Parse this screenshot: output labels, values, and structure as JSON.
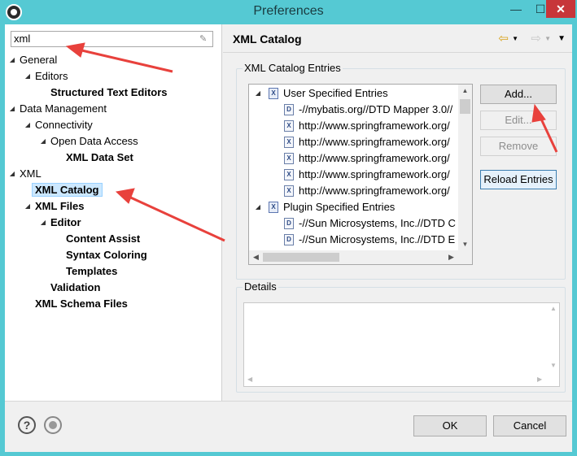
{
  "window": {
    "title": "Preferences"
  },
  "filter": {
    "value": "xml"
  },
  "tree": [
    {
      "label": "General",
      "level": 0,
      "twisty": "open",
      "bold": false
    },
    {
      "label": "Editors",
      "level": 1,
      "twisty": "open",
      "bold": false
    },
    {
      "label": "Structured Text Editors",
      "level": 2,
      "twisty": "none",
      "bold": true
    },
    {
      "label": "Data Management",
      "level": 0,
      "twisty": "open",
      "bold": false
    },
    {
      "label": "Connectivity",
      "level": 1,
      "twisty": "open",
      "bold": false
    },
    {
      "label": "Open Data Access",
      "level": 2,
      "twisty": "open",
      "bold": false
    },
    {
      "label": "XML Data Set",
      "level": 3,
      "twisty": "none",
      "bold": true
    },
    {
      "label": "XML",
      "level": 0,
      "twisty": "open",
      "bold": false
    },
    {
      "label": "XML Catalog",
      "level": 1,
      "twisty": "none",
      "bold": true,
      "selected": true
    },
    {
      "label": "XML Files",
      "level": 1,
      "twisty": "open",
      "bold": true
    },
    {
      "label": "Editor",
      "level": 2,
      "twisty": "open",
      "bold": true
    },
    {
      "label": "Content Assist",
      "level": 3,
      "twisty": "none",
      "bold": true
    },
    {
      "label": "Syntax Coloring",
      "level": 3,
      "twisty": "none",
      "bold": true
    },
    {
      "label": "Templates",
      "level": 3,
      "twisty": "none",
      "bold": true
    },
    {
      "label": "Validation",
      "level": 2,
      "twisty": "none",
      "bold": true
    },
    {
      "label": "XML Schema Files",
      "level": 1,
      "twisty": "none",
      "bold": true
    }
  ],
  "page": {
    "title": "XML Catalog",
    "catalog_group_label": "XML Catalog Entries",
    "details_group_label": "Details"
  },
  "entries": [
    {
      "label": "User Specified Entries",
      "type": "group",
      "icon": "X"
    },
    {
      "label": "-//mybatis.org//DTD Mapper 3.0//",
      "type": "dtd",
      "icon": "D"
    },
    {
      "label": "http://www.springframework.org/",
      "type": "xsd",
      "icon": "X"
    },
    {
      "label": "http://www.springframework.org/",
      "type": "xsd",
      "icon": "X"
    },
    {
      "label": "http://www.springframework.org/",
      "type": "xsd",
      "icon": "X"
    },
    {
      "label": "http://www.springframework.org/",
      "type": "xsd",
      "icon": "X"
    },
    {
      "label": "http://www.springframework.org/",
      "type": "xsd",
      "icon": "X"
    },
    {
      "label": "Plugin Specified Entries",
      "type": "group",
      "icon": "X"
    },
    {
      "label": "-//Sun Microsystems, Inc.//DTD C",
      "type": "dtd",
      "icon": "D"
    },
    {
      "label": "-//Sun Microsystems, Inc.//DTD E",
      "type": "dtd",
      "icon": "D"
    }
  ],
  "buttons": {
    "add": "Add...",
    "edit": "Edit...",
    "remove": "Remove",
    "reload": "Reload Entries",
    "ok": "OK",
    "cancel": "Cancel"
  },
  "icons": {
    "back": "⇦",
    "forward": "⇨",
    "dropdown": "▼",
    "help": "?"
  },
  "colors": {
    "titlebar": "#55c9d3",
    "selection": "#cce8ff",
    "annotation_arrow": "#e8413c"
  }
}
